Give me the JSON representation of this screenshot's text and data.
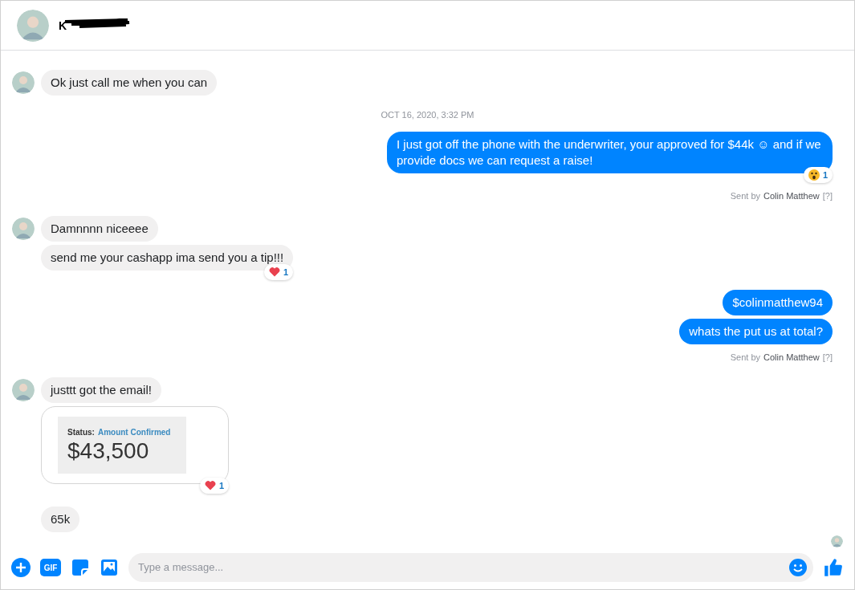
{
  "header": {
    "name": "K"
  },
  "thread": [
    {
      "kind": "incoming",
      "avatar": true,
      "messages": [
        {
          "kind": "text",
          "text": "Ok just call me when you can"
        }
      ]
    },
    {
      "kind": "timestamp",
      "text": "OCT 16, 2020, 3:32 PM"
    },
    {
      "kind": "outgoing",
      "messages": [
        {
          "kind": "text",
          "text": "I just got off the phone with the underwriter, your approved for $44k ☺ and if we provide docs we can request a raise!",
          "reaction": {
            "kind": "wow",
            "count": "1"
          }
        }
      ],
      "sent_by": {
        "prefix": "Sent by",
        "name": "Colin Matthew",
        "help": "[?]"
      }
    },
    {
      "kind": "incoming",
      "avatar": true,
      "messages": [
        {
          "kind": "text",
          "text": "Damnnnn niceeee"
        },
        {
          "kind": "text",
          "text": "send me your cashapp ima send you a tip!!!",
          "reaction": {
            "kind": "heart",
            "count": "1"
          }
        }
      ]
    },
    {
      "kind": "outgoing",
      "messages": [
        {
          "kind": "text",
          "text": "$colinmatthew94"
        },
        {
          "kind": "text",
          "text": "whats the put us at total?"
        }
      ],
      "sent_by": {
        "prefix": "Sent by",
        "name": "Colin Matthew",
        "help": "[?]"
      }
    },
    {
      "kind": "incoming",
      "avatar": true,
      "messages": [
        {
          "kind": "text",
          "text": "justtt got the email!"
        },
        {
          "kind": "card",
          "status_label": "Status:",
          "status_value": "Amount Confirmed",
          "amount": "$43,500",
          "reaction": {
            "kind": "heart",
            "count": "1"
          }
        }
      ]
    },
    {
      "kind": "incoming",
      "avatar": false,
      "messages": [
        {
          "kind": "text",
          "text": "65k"
        }
      ]
    }
  ],
  "read_receipt": true,
  "composer": {
    "placeholder": "Type a message...",
    "gif_label": "GIF"
  }
}
